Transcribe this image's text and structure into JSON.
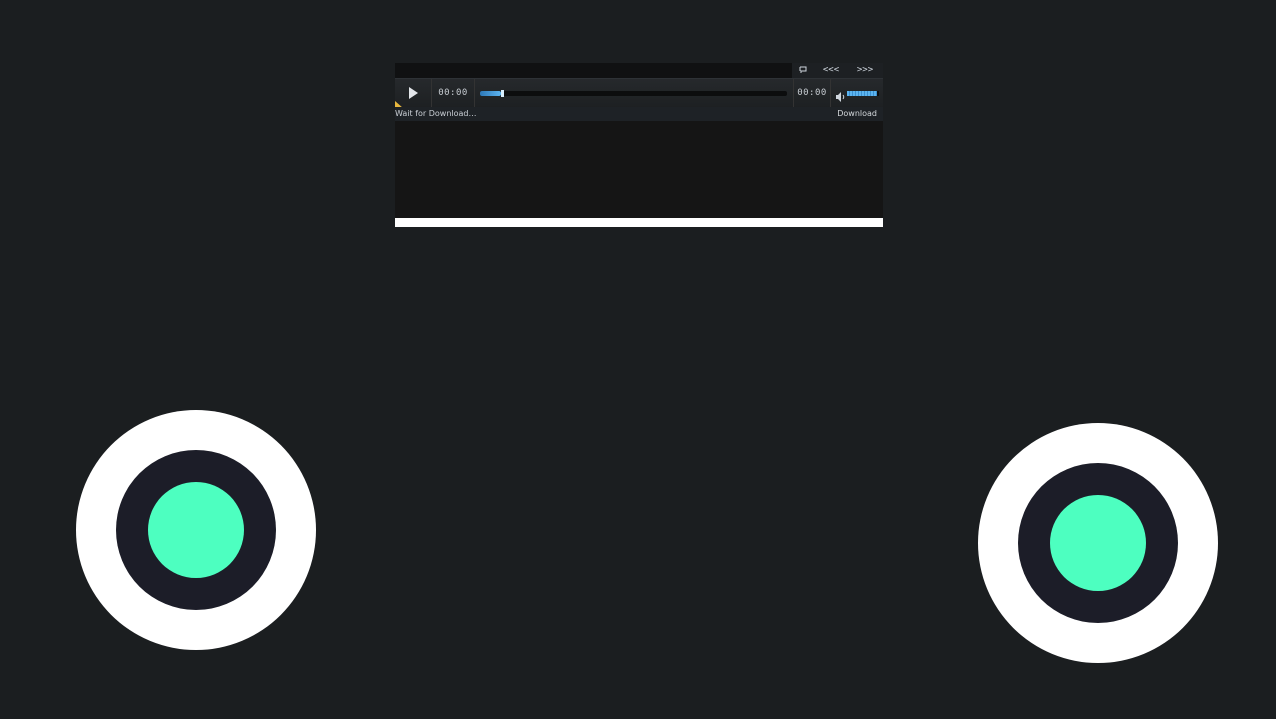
{
  "player": {
    "time_current": "00:00",
    "time_total": "00:00",
    "progress_fraction": 0.07,
    "volume_fraction": 0.95,
    "status_text": "Wait for Download…",
    "download_label": "Download",
    "tools": {
      "repeat_icon": "repeat-icon",
      "prev_label": "<<<",
      "next_label": ">>>"
    },
    "colors": {
      "accent": "#4aa6e8",
      "corner": "#e8b73d"
    }
  },
  "joysticks": {
    "ring_color": "#1c1d28",
    "knob_color": "#4dffc0"
  }
}
